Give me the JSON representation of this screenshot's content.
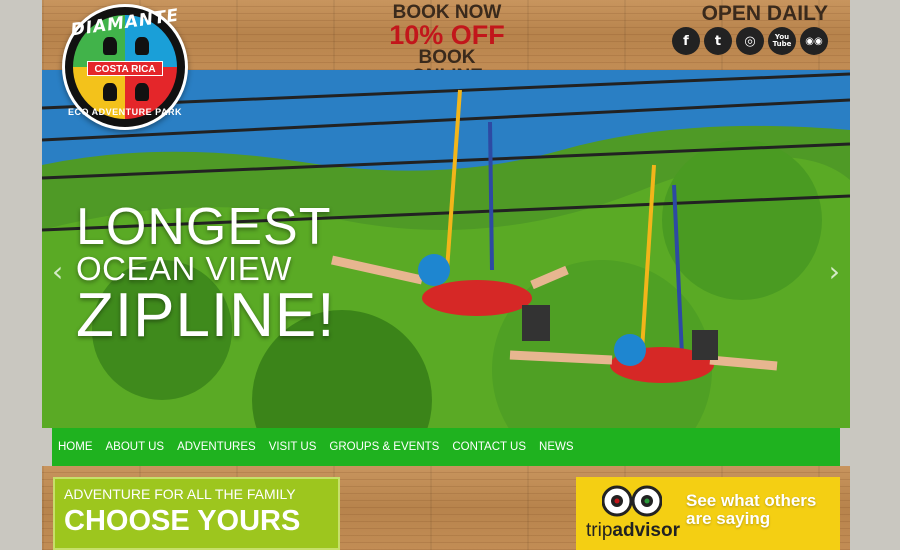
{
  "logo": {
    "name": "DIAMANTE",
    "country": "COSTA RICA",
    "tagline": "ECO ADVENTURE PARK"
  },
  "promo": {
    "line1": "BOOK NOW",
    "line2": "10% OFF",
    "line3": "BOOK ONLINE"
  },
  "hours": {
    "label": "OPEN DAILY"
  },
  "social": [
    {
      "name": "facebook-icon",
      "glyph": "f"
    },
    {
      "name": "twitter-icon",
      "glyph": "t"
    },
    {
      "name": "instagram-icon",
      "glyph": "◎"
    },
    {
      "name": "youtube-icon",
      "glyph": "You Tube"
    },
    {
      "name": "tripadvisor-icon",
      "glyph": "◉◉"
    }
  ],
  "hero": {
    "line1": "LONGEST",
    "line2": "OCEAN VIEW",
    "line3": "ZIPLINE!",
    "prev": "‹",
    "next": "›"
  },
  "nav": [
    "HOME",
    "ABOUT US",
    "ADVENTURES",
    "VISIT US",
    "GROUPS & EVENTS",
    "CONTACT US",
    "NEWS"
  ],
  "family": {
    "line1": "ADVENTURE FOR ALL THE FAMILY",
    "line2": "CHOOSE YOURS"
  },
  "tripadvisor": {
    "brand_a": "trip",
    "brand_b": "advisor",
    "line1": "See what others",
    "line2": "are saying"
  },
  "colors": {
    "nav_green": "#1fb21f",
    "promo_red": "#c2161b",
    "family_green": "#9dc61e",
    "trip_yellow": "#f4cf13"
  }
}
